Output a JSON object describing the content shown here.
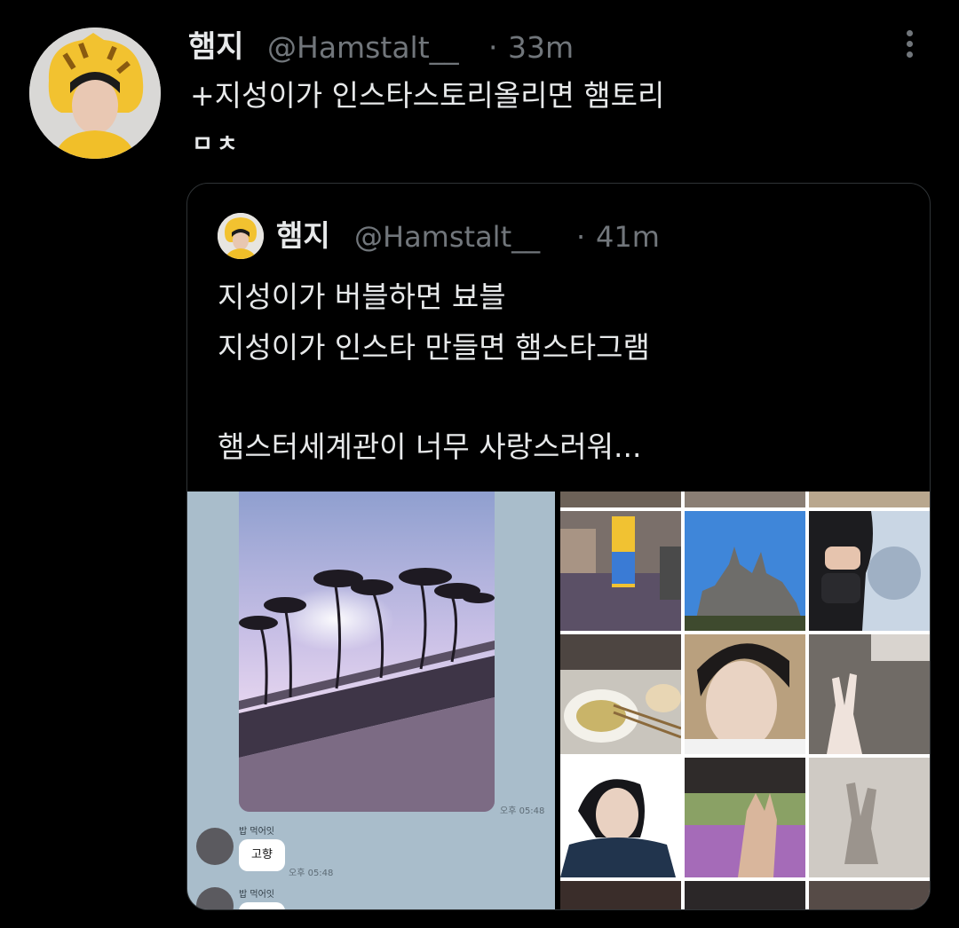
{
  "tweet": {
    "display_name": "햄지",
    "handle": "@Hamstalt__",
    "time": "33m",
    "separator": "·",
    "text_line1": "+지성이가 인스타스토리올리면 햄토리",
    "text_line2": "ㅁㅊ"
  },
  "quote": {
    "display_name": "햄지",
    "handle": "@Hamstalt__",
    "time": "41m",
    "separator": "·",
    "line1": "지성이가 버블하면 뵤블",
    "line2": "지성이가 인스타 만들면 햄스타그램",
    "line3": "햄스터세계관이 너무 사랑스러워..."
  },
  "chat": {
    "photo_time": "오후 05:48",
    "sender1": "밥 먹어잇",
    "bubble1": "고향",
    "bubble1_time": "오후 05:48",
    "sender2": "밥 먹어잇"
  },
  "colors": {
    "background": "#000000",
    "text": "#e7e9ea",
    "muted": "#71767b",
    "border": "#2f3336",
    "chat_bg": "#a9bdcb"
  },
  "icons": [
    "more-options-icon"
  ]
}
